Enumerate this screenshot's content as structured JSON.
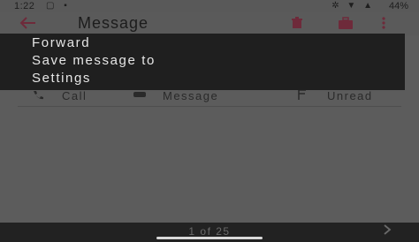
{
  "status_bar": {
    "time": "1:22",
    "left_icons": "▢ ▪",
    "right_icons": "✲ ▼ ▲",
    "battery": "44%"
  },
  "app_bar": {
    "back_icon": "arrow-left-icon",
    "title": "Message",
    "icons": [
      "trash-icon",
      "briefcase-icon",
      "overflow-menu-icon"
    ]
  },
  "menu": {
    "items": [
      {
        "label": "Forward"
      },
      {
        "label": "Save message to"
      },
      {
        "label": "Settings"
      }
    ]
  },
  "actions": {
    "call": {
      "label": "Call",
      "icon": "phone-icon"
    },
    "message": {
      "label": "Message",
      "icon": "message-icon"
    },
    "unread": {
      "label": "Unread",
      "icon": "flag-icon"
    }
  },
  "pager": {
    "text": "1 of 25",
    "next_icon": "chevron-right-icon"
  },
  "colors": {
    "accent": "#6e2a3a",
    "menu_bg": "#1f1f1f",
    "menu_text": "#e6e6e6",
    "scrim": "#5c5c5c"
  }
}
